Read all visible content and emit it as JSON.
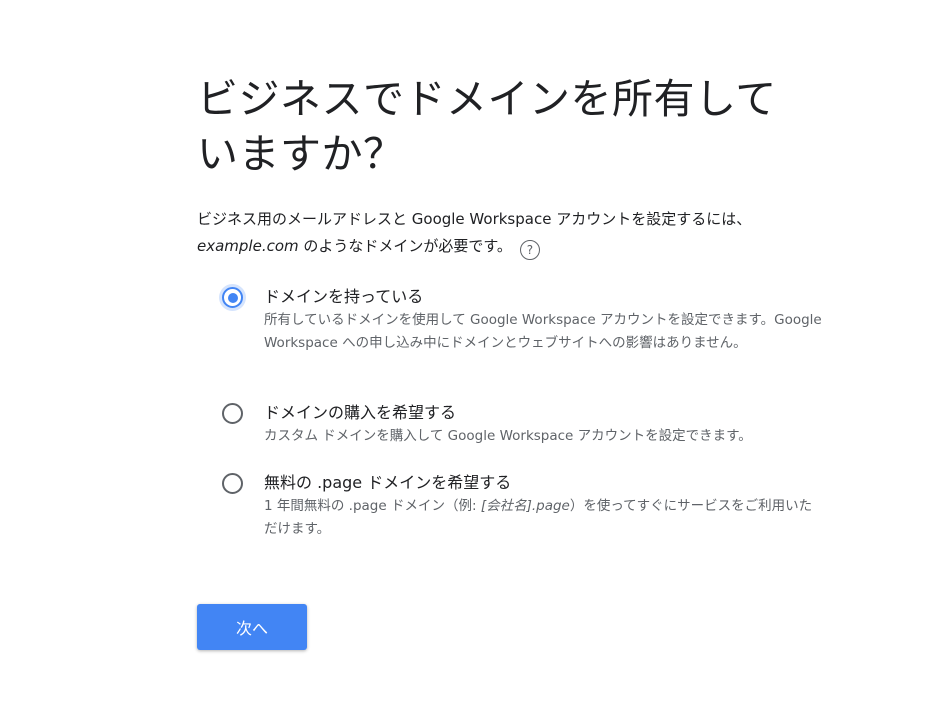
{
  "title": "ビジネスでドメインを所有していますか？",
  "description": {
    "line1": "ビジネス用のメールアドレスと Google Workspace アカウントを設定するには、",
    "example": "example.com",
    "line2_rest": " のようなドメインが必要です。",
    "help_glyph": "?"
  },
  "options": [
    {
      "label": "ドメインを持っている",
      "checked": true,
      "description": "所有しているドメインを使用して Google Workspace アカウントを設定できます。Google Workspace への申し込み中にドメインとウェブサイトへの影響はありません。"
    },
    {
      "label": "ドメインの購入を希望する",
      "checked": false,
      "description": "カスタム ドメインを購入して Google Workspace アカウントを設定できます。"
    },
    {
      "label": "無料の .page ドメインを希望する",
      "checked": false,
      "description_pre": "1 年間無料の .page ドメイン（例: ",
      "description_em": "[会社名].page",
      "description_post": "）を使ってすぐにサービスをご利用いただけます。"
    }
  ],
  "next_button": {
    "label": "次へ"
  },
  "colors": {
    "accent": "#4285f4",
    "text": "#202124",
    "secondary_text": "#5f6368"
  }
}
